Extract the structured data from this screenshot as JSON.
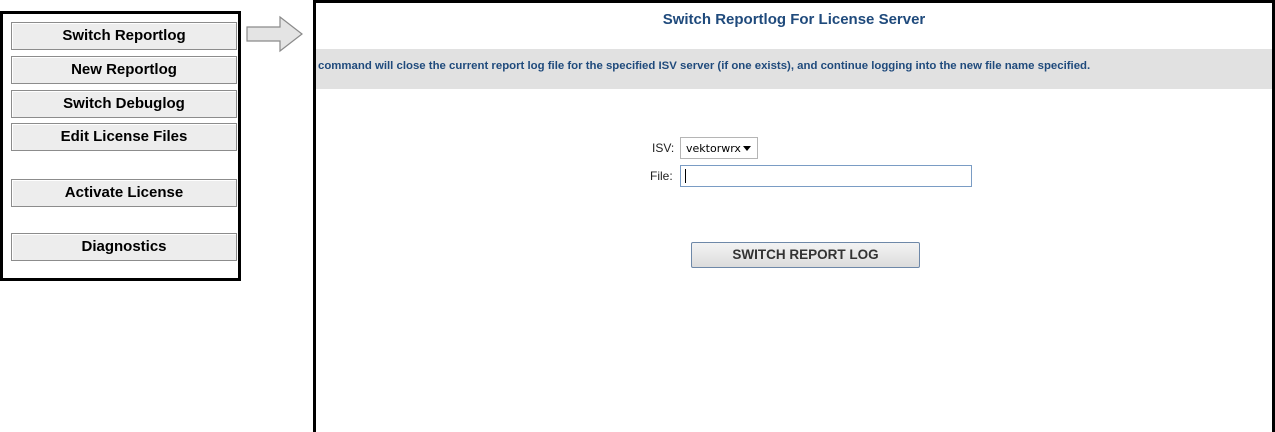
{
  "menu": {
    "items": [
      {
        "label": "Switch Reportlog"
      },
      {
        "label": "New Reportlog"
      },
      {
        "label": "Switch Debuglog"
      },
      {
        "label": "Edit License Files"
      },
      {
        "label": "Activate License"
      },
      {
        "label": "Diagnostics"
      }
    ]
  },
  "page": {
    "title": "Switch Reportlog For License Server",
    "description": "command will close the current report log file for the specified ISV server (if one exists), and continue logging into the new file name specified."
  },
  "form": {
    "isv_label": "ISV:",
    "isv_value": "vektorwrx",
    "file_label": "File:",
    "file_value": "",
    "submit_label": "SWITCH REPORT LOG"
  },
  "colors": {
    "heading": "#1f4a7c",
    "description_bar": "#e1e1e1",
    "menu_button": "#ededed"
  },
  "icons": {
    "pointer_arrow": "right-arrow-icon",
    "dropdown": "chevron-down-icon"
  }
}
